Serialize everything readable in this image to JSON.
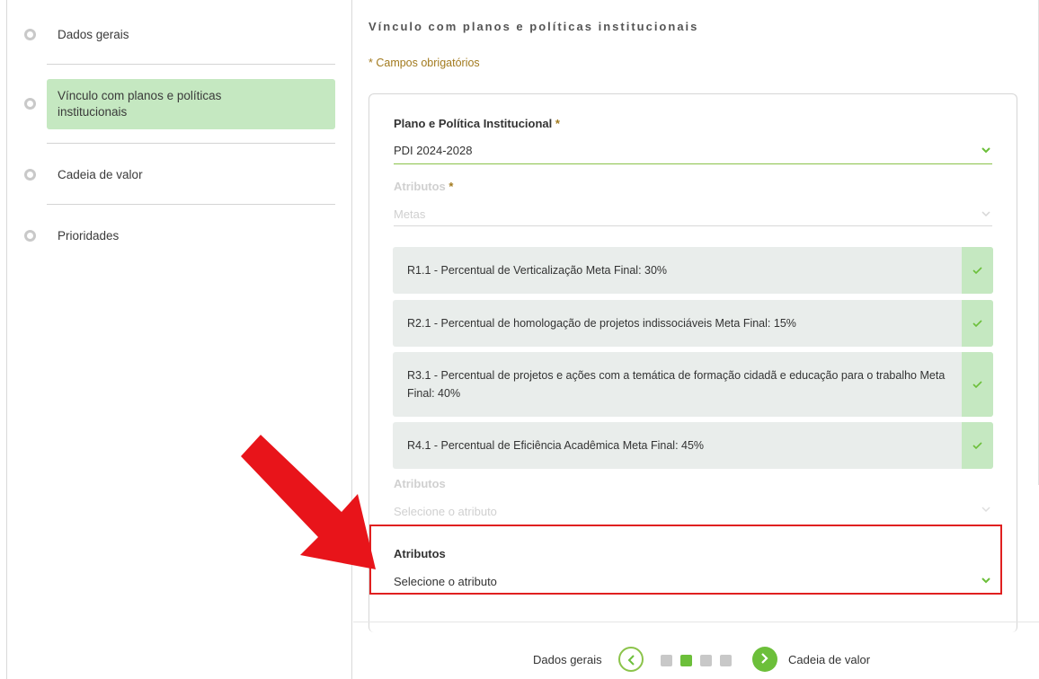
{
  "sidebar": {
    "steps": [
      {
        "label": "Dados gerais"
      },
      {
        "label": "Vínculo com planos e políticas institucionais"
      },
      {
        "label": "Cadeia de valor"
      },
      {
        "label": "Prioridades"
      }
    ]
  },
  "main": {
    "section_title": "Vínculo com planos e políticas institucionais",
    "required_note": "* Campos obrigatórios",
    "plano_field": {
      "label": "Plano e Política Institucional",
      "required_mark": "*",
      "value": "PDI 2024-2028"
    },
    "atributos_field_1": {
      "label": "Atributos",
      "required_mark": "*",
      "value": "Metas"
    },
    "selected_items": [
      {
        "text": "R1.1 - Percentual de Verticalização Meta Final: 30%"
      },
      {
        "text": "R2.1 - Percentual de homologação de projetos indissociáveis Meta Final: 15%"
      },
      {
        "text": "R3.1 - Percentual de projetos e ações com a temática de formação cidadã e educação para o trabalho Meta Final: 40%"
      },
      {
        "text": "R4.1 - Percentual de Eficiência Acadêmica Meta Final: 45%"
      }
    ],
    "atributos_field_2": {
      "label": "Atributos",
      "placeholder": "Selecione o atributo"
    },
    "atributos_field_3": {
      "label": "Atributos",
      "placeholder": "Selecione o atributo"
    }
  },
  "pager": {
    "prev_label": "Dados gerais",
    "next_label": "Cadeia de valor",
    "total_steps": 4,
    "current_step": 2
  },
  "colors": {
    "accent_green": "#6cbf3a",
    "active_step_bg": "#c5e8c1",
    "highlight_red": "#e02020",
    "required_gold": "#a27a1e"
  }
}
